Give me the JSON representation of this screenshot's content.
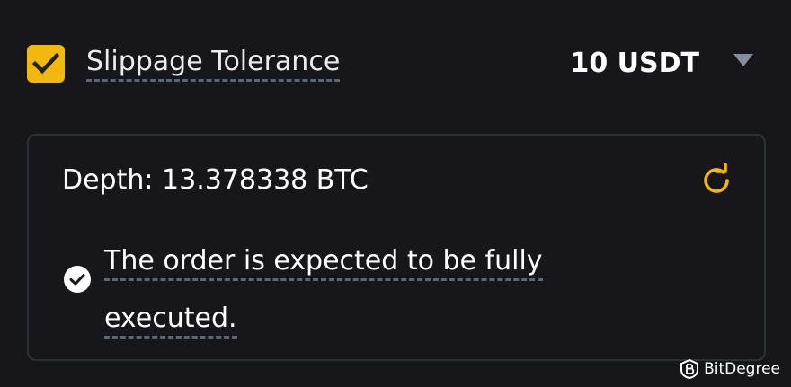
{
  "slippage": {
    "checked": true,
    "label": "Slippage Tolerance",
    "value": "10 USDT"
  },
  "depth": {
    "text": "Depth: 13.378338 BTC",
    "status_message": "The order is expected to be fully executed."
  },
  "watermark": {
    "brand": "BitDegree"
  },
  "colors": {
    "background": "#17171b",
    "accent": "#f0b90b",
    "muted": "#848e9c",
    "border": "#2b3139"
  },
  "icons": {
    "checkbox": "check-icon",
    "dropdown": "caret-down-icon",
    "refresh": "refresh-icon",
    "status": "check-circle-icon"
  }
}
